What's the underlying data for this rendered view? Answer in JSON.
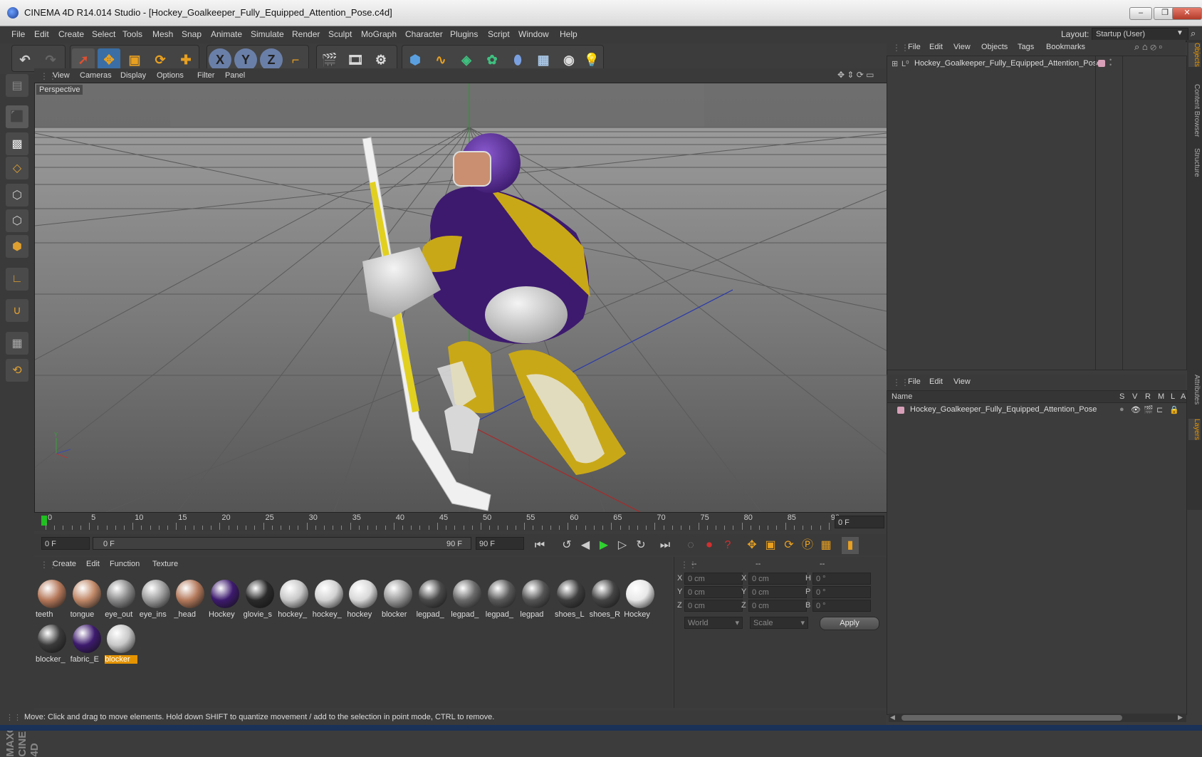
{
  "window": {
    "title": "CINEMA 4D R14.014 Studio - [Hockey_Goalkeeper_Fully_Equipped_Attention_Pose.c4d]",
    "controls": [
      "–",
      "❐",
      "✕"
    ]
  },
  "menubar": {
    "items": [
      "File",
      "Edit",
      "Create",
      "Select",
      "Tools",
      "Mesh",
      "Snap",
      "Animate",
      "Simulate",
      "Render",
      "Sculpt",
      "MoGraph",
      "Character",
      "Plugins",
      "Script",
      "Window",
      "Help"
    ],
    "layout_label": "Layout:",
    "layout_value": "Startup (User)"
  },
  "viewport": {
    "menu": [
      "View",
      "Cameras",
      "Display",
      "Options",
      "Filter",
      "Panel"
    ],
    "label": "Perspective"
  },
  "timeline": {
    "ticks": [
      "0",
      "5",
      "10",
      "15",
      "20",
      "25",
      "30",
      "35",
      "40",
      "45",
      "50",
      "55",
      "60",
      "65",
      "70",
      "75",
      "80",
      "85",
      "90"
    ],
    "current_frame_field": "0 F",
    "start_field": "0 F",
    "range_start": "0 F",
    "range_end": "90 F",
    "end_field": "90 F"
  },
  "materials": {
    "menu": [
      "Create",
      "Edit",
      "Function",
      "Texture"
    ],
    "items": [
      {
        "label": "teeth",
        "color": "#b5785a"
      },
      {
        "label": "tongue",
        "color": "#c08868"
      },
      {
        "label": "eye_out",
        "color": "#8a8a8a"
      },
      {
        "label": "eye_ins",
        "color": "#9c9c9c"
      },
      {
        "label": "_head",
        "color": "#b47a5c"
      },
      {
        "label": "Hockey",
        "color": "#3d1a6e"
      },
      {
        "label": "glovie_s",
        "color": "#2a2a2a"
      },
      {
        "label": "hockey_",
        "color": "#c8c8c8"
      },
      {
        "label": "hockey_",
        "color": "#d2d2d2"
      },
      {
        "label": "hockey",
        "color": "#d8d8d8"
      },
      {
        "label": "blocker",
        "color": "#9a9a9a"
      },
      {
        "label": "legpad_",
        "color": "#4a4a4a"
      },
      {
        "label": "legpad_",
        "color": "#6a6a6a"
      },
      {
        "label": "legpad_",
        "color": "#5a5a5a"
      },
      {
        "label": "legpad",
        "color": "#555555"
      },
      {
        "label": "shoes_L",
        "color": "#3e3e3e"
      },
      {
        "label": "shoes_R",
        "color": "#444444"
      },
      {
        "label": "Hockey",
        "color": "#e8e8e8"
      },
      {
        "label": "blocker_",
        "color": "#3a3a3a"
      },
      {
        "label": "fabric_E",
        "color": "#3d1a6e"
      },
      {
        "label": "blocker",
        "color": "#c8c8c8"
      }
    ],
    "selected_index": 20
  },
  "coordinates": {
    "headers": [
      "--",
      "--",
      "--"
    ],
    "rows": [
      {
        "a": "X",
        "av": "0 cm",
        "b": "X",
        "bv": "0 cm",
        "c": "H",
        "cv": "0 °"
      },
      {
        "a": "Y",
        "av": "0 cm",
        "b": "Y",
        "bv": "0 cm",
        "c": "P",
        "cv": "0 °"
      },
      {
        "a": "Z",
        "av": "0 cm",
        "b": "Z",
        "bv": "0 cm",
        "c": "B",
        "cv": "0 °"
      }
    ],
    "space": "World",
    "mode": "Scale",
    "apply": "Apply"
  },
  "objects": {
    "menu": [
      "File",
      "Edit",
      "View",
      "Objects",
      "Tags",
      "Bookmarks"
    ],
    "items": [
      "Hockey_Goalkeeper_Fully_Equipped_Attention_Pose"
    ]
  },
  "layers": {
    "menu": [
      "File",
      "Edit",
      "View"
    ],
    "columns": [
      "Name",
      "S",
      "V",
      "R",
      "M",
      "L",
      "A"
    ],
    "items": [
      "Hockey_Goalkeeper_Fully_Equipped_Attention_Pose"
    ]
  },
  "side_tabs": [
    "Objects",
    "Content Browser",
    "Structure",
    "Attributes",
    "Layers"
  ],
  "status": "Move: Click and drag to move elements. Hold down SHIFT to quantize movement / add to the selection in point mode, CTRL to remove.",
  "logo": [
    "MAXON",
    "CINEMA 4D"
  ],
  "colors": {
    "accent": "#e59400",
    "jersey": "#3d1a6e",
    "pads": "#c9a818"
  }
}
